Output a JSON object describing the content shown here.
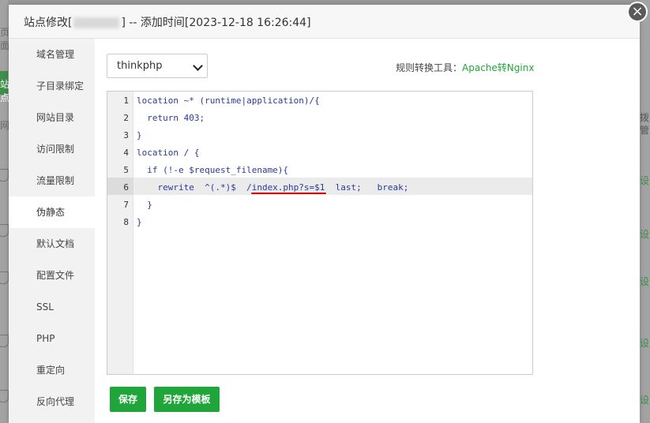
{
  "dialog": {
    "title_prefix": "站点修改[",
    "title_suffix": "] -- 添加时间[2023-12-18 16:26:44]",
    "close_glyph": "×"
  },
  "sidenav": {
    "items": [
      {
        "label": "域名管理"
      },
      {
        "label": "子目录绑定"
      },
      {
        "label": "网站目录"
      },
      {
        "label": "访问限制"
      },
      {
        "label": "流量限制"
      },
      {
        "label": "伪静态",
        "active": true
      },
      {
        "label": "默认文档"
      },
      {
        "label": "配置文件"
      },
      {
        "label": "SSL"
      },
      {
        "label": "PHP"
      },
      {
        "label": "重定向"
      },
      {
        "label": "反向代理"
      }
    ]
  },
  "rewrite": {
    "template_select": "thinkphp",
    "tool_label": "规则转换工具：",
    "tool_link": "Apache转Nginx"
  },
  "editor": {
    "line_numbers": [
      "1",
      "2",
      "3",
      "4",
      "5",
      "6",
      "7",
      "8"
    ],
    "lines": [
      "location ~* (runtime|application)/{",
      "  return 403;",
      "}",
      "location / {",
      "  if (!-e $request_filename){",
      "    rewrite  ^(.*)$  /index.php?s=$1  last;   break;",
      "  }",
      "}"
    ],
    "highlighted_line": 6
  },
  "buttons": {
    "save": "保存",
    "save_as_template": "另存为模板"
  },
  "background": {
    "left_texts": [
      "页面",
      "站点",
      "网"
    ],
    "right_texts": [
      "拨",
      "管"
    ],
    "right_setting": "设"
  },
  "colors": {
    "accent": "#20a53a",
    "underline": "#d40000"
  }
}
